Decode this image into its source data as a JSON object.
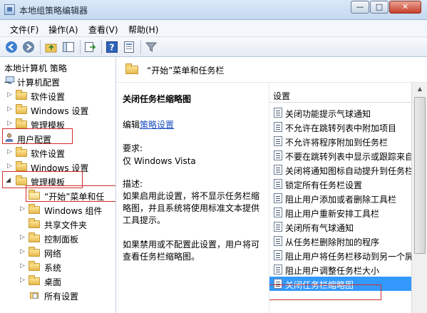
{
  "window": {
    "title": "本地组策略编辑器",
    "minimize_glyph": "—",
    "maximize_glyph": "□",
    "close_glyph": "✕"
  },
  "menu": {
    "file": "文件(F)",
    "action": "操作(A)",
    "view": "查看(V)",
    "help": "帮助(H)"
  },
  "toolbar": {
    "icons": [
      "back-icon",
      "forward-icon",
      "up-folder-icon",
      "show-hide-tree-icon",
      "export-list-icon",
      "help-icon",
      "properties-icon",
      "filter-icon"
    ]
  },
  "tree": {
    "root": "本地计算机 策略",
    "computer_config": "计算机配置",
    "software_settings_1": "软件设置",
    "windows_settings_1": "Windows 设置",
    "admin_templates_1": "管理模板",
    "user_config": "用户配置",
    "software_settings_2": "软件设置",
    "windows_settings_2": "Windows 设置",
    "admin_templates_2": "管理模板",
    "start_menu": "“开始”菜单和任",
    "windows_components": "Windows 组件",
    "shared_folders": "共享文件夹",
    "control_panel": "控制面板",
    "network": "网络",
    "system": "系统",
    "desktop": "桌面",
    "all_settings": "所有设置"
  },
  "middle": {
    "header_title": "“开始”菜单和任务栏",
    "policy_title": "关闭任务栏缩略图",
    "edit_prefix": "编辑",
    "edit_link": "策略设置",
    "requirements_label": "要求:",
    "requirements_value": "仅 Windows Vista",
    "description_label": "描述:",
    "description_enabled": "如果启用此设置，将不显示任务栏缩略图，并且系统将使用标准文本提供工具提示。",
    "description_disabled": "如果禁用或不配置此设置，用户将可查看任务栏缩略图。"
  },
  "settings": {
    "column_header": "设置",
    "items": [
      "关闭功能提示气球通知",
      "不允许在跳转列表中附加项目",
      "不允许将程序附加到任务栏",
      "不要在跳转列表中显示或跟踪来自",
      "关闭将通知图标自动提升到任务栏",
      "锁定所有任务栏设置",
      "阻止用户添加或者删除工具栏",
      "阻止用户重新安排工具栏",
      "关闭所有气球通知",
      "从任务栏删除附加的程序",
      "阻止用户将任务栏移动到另一个屏",
      "阻止用户调整任务栏大小",
      "关闭任务栏缩略图"
    ],
    "selected_index": 12
  },
  "colors": {
    "highlight_box": "#d22c2c",
    "selection": "#3399ff"
  }
}
